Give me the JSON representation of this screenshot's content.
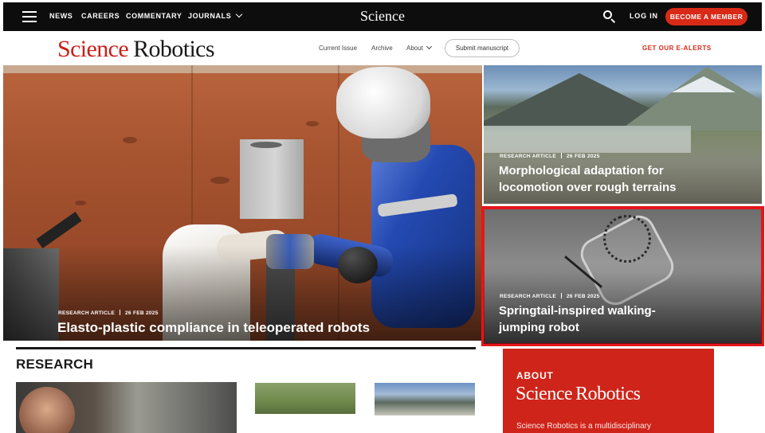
{
  "topbar": {
    "nav": [
      "NEWS",
      "CAREERS",
      "COMMENTARY",
      "JOURNALS"
    ],
    "brand": "Science",
    "login": "LOG IN",
    "member_button": "BECOME A MEMBER"
  },
  "subnav": {
    "logo_science": "Science",
    "logo_robotics": "Robotics",
    "links": [
      "Current Issue",
      "Archive",
      "About"
    ],
    "submit": "Submit manuscript",
    "ealerts": "GET OUR E-ALERTS"
  },
  "hero": {
    "main": {
      "type": "RESEARCH ARTICLE",
      "date": "26 FEB 2025",
      "title": "Elasto-plastic compliance in teleoperated robots"
    },
    "right_top": {
      "type": "RESEARCH ARTICLE",
      "date": "26 FEB 2025",
      "title_line1": "Morphological adaptation for",
      "title_line2": "locomotion over rough terrains"
    },
    "right_bottom": {
      "type": "RESEARCH ARTICLE",
      "date": "26 FEB 2025",
      "title_line1": "Springtail-inspired walking-",
      "title_line2": "jumping robot",
      "highlight_color": "#e4161b"
    }
  },
  "research": {
    "heading": "RESEARCH"
  },
  "about": {
    "label": "ABOUT",
    "logo_science": "Science",
    "logo_robotics": "Robotics",
    "description_partial": "Science Robotics is a multidisciplinary"
  },
  "colors": {
    "brand_red": "#d82a17",
    "about_red": "#cf2419",
    "topbar": "#0d0d0d"
  }
}
